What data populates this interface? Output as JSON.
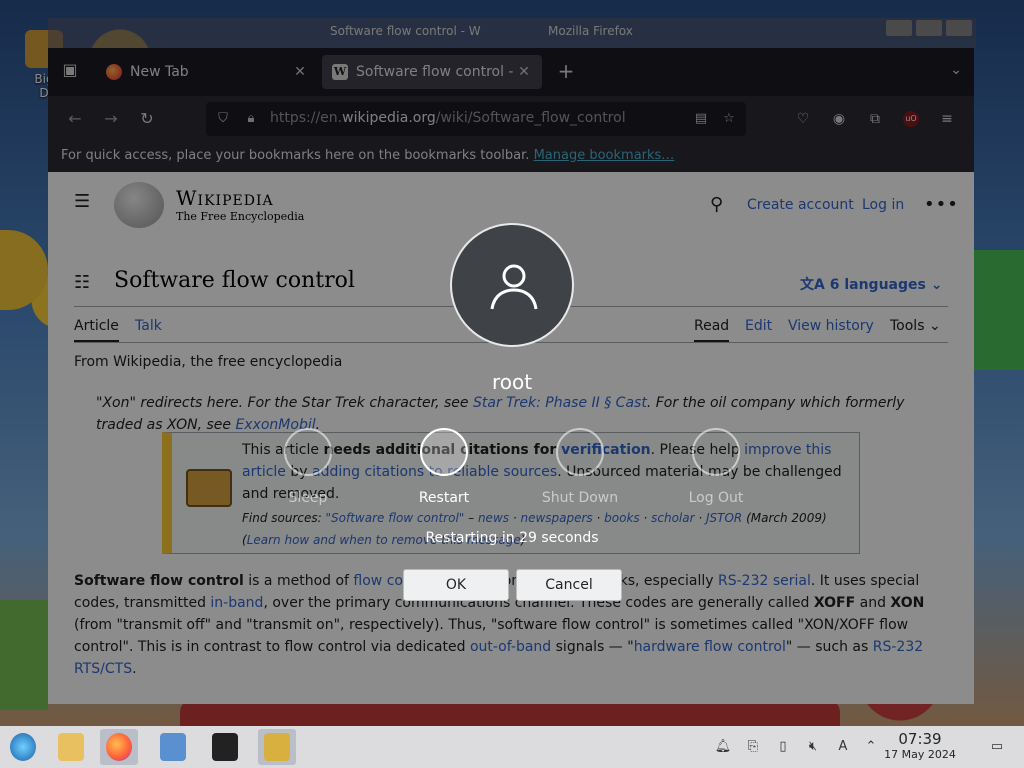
{
  "desktop": {
    "icon_label": "Big\nD",
    "bg_window_title": "Software flow control - W",
    "bg_window_title2": "Mozilla Firefox"
  },
  "browser": {
    "tabs": [
      {
        "label": "New Tab",
        "favicon": "firefox-icon"
      },
      {
        "label": "Software flow control - Wikipedia",
        "favicon": "wikipedia-icon"
      }
    ],
    "url_prefix": "https://en.",
    "url_host": "wikipedia.org",
    "url_path": "/wiki/Software_flow_control",
    "bookmarks_hint": "For quick access, place your bookmarks here on the bookmarks toolbar.",
    "bookmarks_link": "Manage bookmarks…"
  },
  "wiki": {
    "wordmark": "Wikipedia",
    "tagline": "The Free Encyclopedia",
    "create_account": "Create account",
    "login": "Log in",
    "title": "Software flow control",
    "languages": "6 languages",
    "tab_article": "Article",
    "tab_talk": "Talk",
    "tab_read": "Read",
    "tab_edit": "Edit",
    "tab_history": "View history",
    "tab_tools": "Tools",
    "from": "From Wikipedia, the free encyclopedia",
    "hatnote_1": "\"Xon\" redirects here. For the Star Trek character, see ",
    "hatnote_link1": "Star Trek: Phase II § Cast",
    "hatnote_2": ". For the oil company which formerly traded as XON, see ",
    "hatnote_link2": "ExxonMobil",
    "hatnote_3": ".",
    "ambox_1": "This article ",
    "ambox_bold": "needs additional citations for ",
    "ambox_link1": "verification",
    "ambox_2": ". Please help ",
    "ambox_link2": "improve this article",
    "ambox_3": " by ",
    "ambox_link3": "adding citations to reliable sources",
    "ambox_4": ". Unsourced material may be challenged and removed.",
    "find_label": "Find sources: ",
    "find_q": "\"Software flow control\"",
    "find_news": "news",
    "find_newspapers": "newspapers",
    "find_books": "books",
    "find_scholar": "scholar",
    "find_jstor": "JSTOR",
    "find_date": " (March 2009)",
    "find_learn": "Learn how and when to remove this message",
    "lead_bold": "Software flow control",
    "lead_1": " is a method of ",
    "lead_link1": "flow control",
    "lead_2": " used in computer data links, especially ",
    "lead_link2": "RS-232 serial",
    "lead_3": ". It uses special codes, transmitted ",
    "lead_link3": "in-band",
    "lead_4": ", over the primary communications channel. These codes are generally called ",
    "lead_xoff": "XOFF",
    "lead_and": " and ",
    "lead_xon": "XON",
    "lead_5": " (from \"transmit off\" and \"transmit on\", respectively). Thus, \"software flow control\" is sometimes called \"XON/XOFF flow control\". This is in contrast to flow control via dedicated ",
    "lead_link4": "out-of-band",
    "lead_6": " signals — \"",
    "lead_link5": "hardware flow control",
    "lead_7": "\" — such as ",
    "lead_link6": "RS-232 RTS/CTS",
    "lead_8": "."
  },
  "logout_dialog": {
    "username": "root",
    "actions": [
      {
        "label": "Sleep",
        "icon": "sleep-icon",
        "selected": false
      },
      {
        "label": "Restart",
        "icon": "restart-icon",
        "selected": true
      },
      {
        "label": "Shut Down",
        "icon": "power-icon",
        "selected": false
      },
      {
        "label": "Log Out",
        "icon": "logout-icon",
        "selected": false
      }
    ],
    "countdown": "Restarting in 29 seconds",
    "ok": "OK",
    "cancel": "Cancel"
  },
  "taskbar": {
    "time": "07:39",
    "date": "17 May 2024"
  }
}
